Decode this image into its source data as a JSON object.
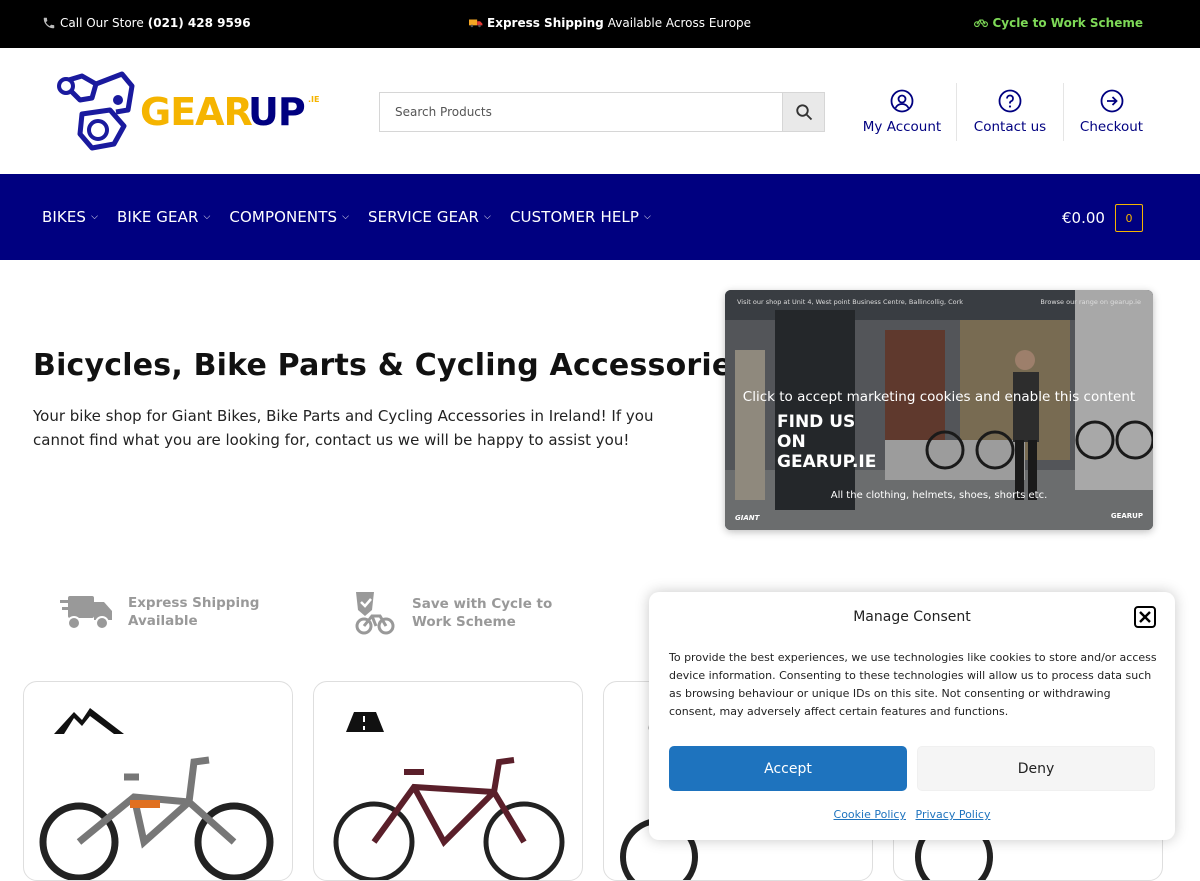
{
  "topbar": {
    "call_prefix": "Call Our Store",
    "phone": "(021) 428 9596",
    "shipping_bold": "Express Shipping",
    "shipping_rest": "Available Across Europe",
    "cycle_scheme": "Cycle to Work Scheme"
  },
  "header": {
    "logo_text": "GEARUP",
    "logo_suffix": ".IE",
    "search_placeholder": "Search Products",
    "links": {
      "account": "My Account",
      "contact": "Contact us",
      "checkout": "Checkout"
    }
  },
  "nav": {
    "items": [
      "BIKES",
      "BIKE GEAR",
      "COMPONENTS",
      "SERVICE GEAR",
      "CUSTOMER HELP"
    ],
    "cart_total": "€0.00",
    "cart_count": "0"
  },
  "hero": {
    "title": "Bicycles, Bike Parts & Cycling Accessories",
    "text": "Your bike shop for Giant Bikes, Bike Parts and Cycling Accessories in Ireland! If you cannot find what you are looking for, contact us we will be happy to assist you!"
  },
  "video": {
    "top_left": "Visit our shop at Unit 4, West point Business Centre, Ballincollig, Cork",
    "top_right": "Browse our range on gearup.ie",
    "overlay": "Click to accept marketing cookies and enable this content",
    "sign_text": [
      "FIND US",
      "ON",
      "GEARUP.IE"
    ],
    "caption": "All the clothing, helmets, shoes, shorts etc.",
    "brand_left": "GIANT",
    "brand_right": "GEARUP"
  },
  "features": [
    {
      "line1": "Express Shipping",
      "line2": "Available",
      "icon": "truck-icon"
    },
    {
      "line1": "Save with Cycle to",
      "line2": "Work Scheme",
      "icon": "bike-badge-icon"
    }
  ],
  "cards": [
    {
      "icon": "mountain-icon"
    },
    {
      "icon": "road-icon"
    },
    {
      "icon": "refresh-icon"
    },
    {
      "icon": "bike-icon"
    }
  ],
  "consent": {
    "title": "Manage Consent",
    "text": "To provide the best experiences, we use technologies like cookies to store and/or access device information. Consenting to these technologies will allow us to process data such as browsing behaviour or unique IDs on this site. Not consenting or withdrawing consent, may adversely affect certain features and functions.",
    "accept": "Accept",
    "deny": "Deny",
    "cookie_policy": "Cookie Policy",
    "privacy_policy": "Privacy Policy"
  },
  "colors": {
    "nav_bg": "#000080",
    "accent_yellow": "#f5b400",
    "green": "#7ed957",
    "accept_blue": "#1e73be"
  }
}
